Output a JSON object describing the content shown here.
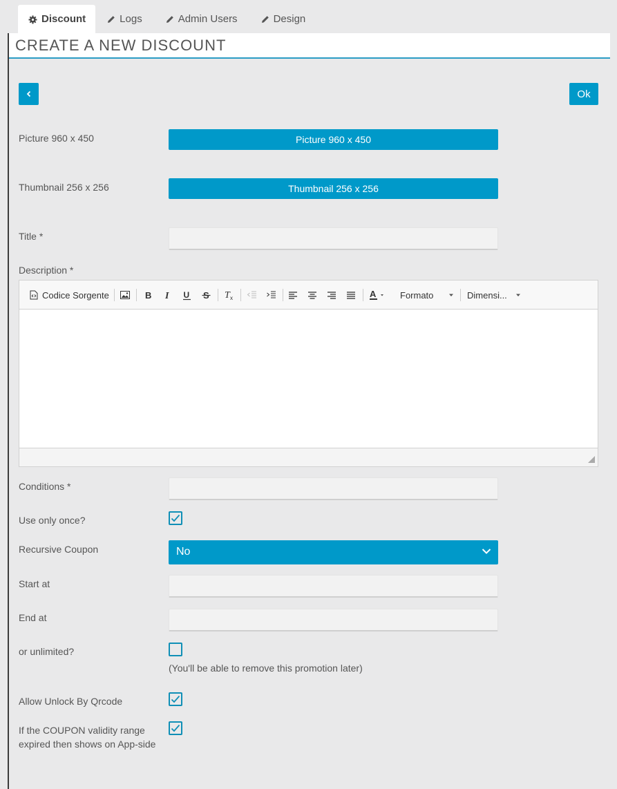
{
  "tabs": [
    {
      "label": "Discount",
      "icon": "gear-icon",
      "active": true
    },
    {
      "label": "Logs",
      "icon": "pencil-icon"
    },
    {
      "label": "Admin Users",
      "icon": "pencil-icon"
    },
    {
      "label": "Design",
      "icon": "pencil-icon"
    }
  ],
  "page": {
    "title": "CREATE A NEW DISCOUNT"
  },
  "actions": {
    "back_icon": "chevron-left-icon",
    "ok_label": "Ok"
  },
  "form": {
    "picture": {
      "label": "Picture 960 x 450",
      "button": "Picture 960 x 450"
    },
    "thumbnail": {
      "label": "Thumbnail 256 x 256",
      "button": "Thumbnail 256 x 256"
    },
    "title": {
      "label": "Title *",
      "value": ""
    },
    "description": {
      "label": "Description *"
    },
    "conditions": {
      "label": "Conditions *",
      "value": ""
    },
    "use_once": {
      "label": "Use only once?",
      "checked": true
    },
    "recursive": {
      "label": "Recursive Coupon",
      "value": "No"
    },
    "start_at": {
      "label": "Start at",
      "value": ""
    },
    "end_at": {
      "label": "End at",
      "value": ""
    },
    "unlimited": {
      "label": "or unlimited?",
      "checked": false,
      "hint": "(You'll be able to remove this promotion later)"
    },
    "qrcode": {
      "label": "Allow Unlock By Qrcode",
      "checked": true
    },
    "expired": {
      "label": "If the COUPON validity range expired then shows on App-side",
      "checked": true
    }
  },
  "editor": {
    "source_label": "Codice Sorgente",
    "format_label": "Formato",
    "size_label": "Dimensi..."
  },
  "colors": {
    "accent": "#0099c9",
    "background": "#e9e9ea",
    "title_underline": "#2a9cc5"
  }
}
